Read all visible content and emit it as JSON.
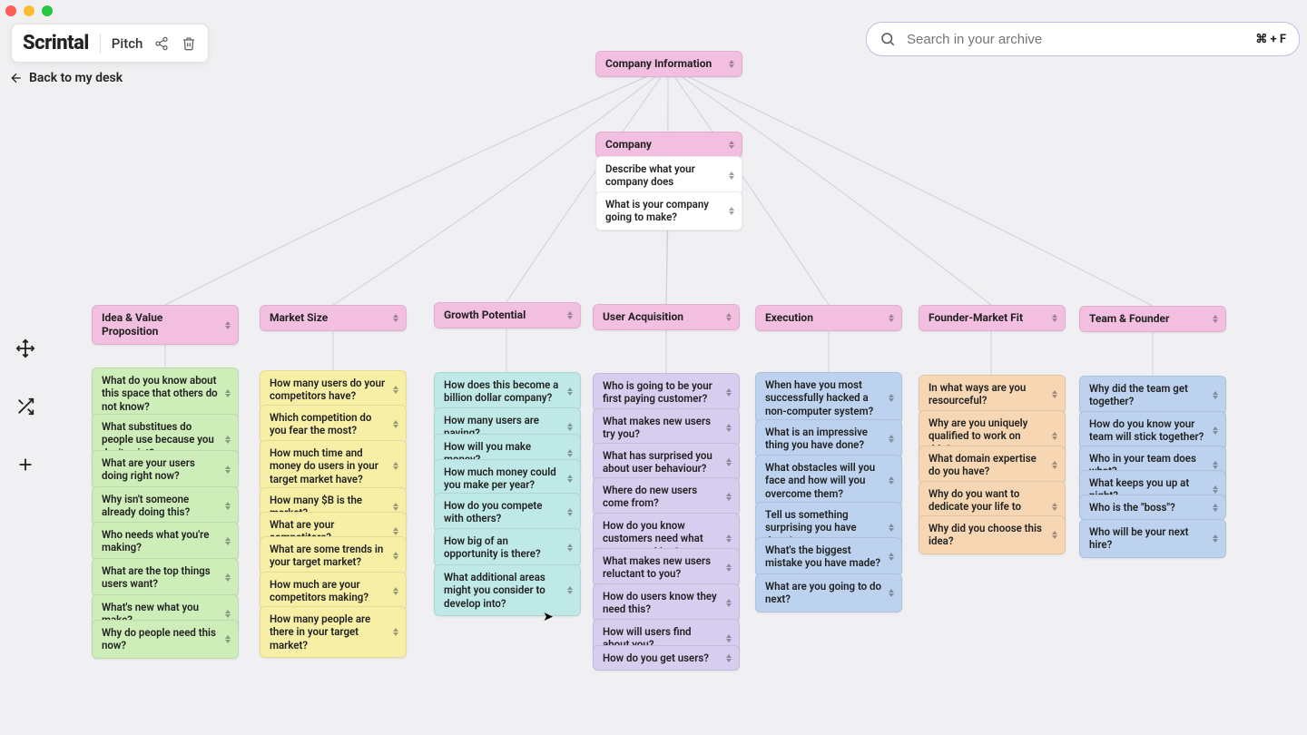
{
  "window": {
    "traffic": {
      "close": "#ff5f57",
      "min": "#febc2e",
      "max": "#28c840"
    }
  },
  "header": {
    "brand": "Scrintal",
    "doc": "Pitch",
    "back": "Back to my desk"
  },
  "search": {
    "placeholder": "Search in your archive",
    "shortcut": "⌘ + F"
  },
  "root": {
    "label": "Company Information"
  },
  "company": {
    "header": "Company",
    "q1": "Describe what your company does",
    "q2": "What is your company going to make?"
  },
  "cols": {
    "idea": {
      "title": "Idea & Value Proposition",
      "items": [
        "What do you know about this space that others do not know?",
        "What substitues do people use because you don't exist?",
        "What are your users doing right now?",
        "Why isn't someone already doing this?",
        "Who needs what you're making?",
        "What are the top things users want?",
        "What's new what you make?",
        "Why do people need this now?"
      ]
    },
    "market": {
      "title": "Market Size",
      "items": [
        "How many users do your competitors have?",
        "Which competition do you fear the most?",
        "How much time and money do users in your target market have?",
        "How many $B is the market?",
        "What are your competitors?",
        "What are some trends in your target market?",
        "How much are your competitors making?",
        "How many people are there in your target market?"
      ]
    },
    "growth": {
      "title": "Growth Potential",
      "items": [
        "How does this become a billion dollar company?",
        "How many users are paying?",
        "How will you make money?",
        "How much money could you make per year?",
        "How do you compete with others?",
        "How big of an opportunity is there?",
        "What additional areas might you consider to develop into?"
      ]
    },
    "user": {
      "title": "User Acquisition",
      "items": [
        "Who is going to be your first paying customer?",
        "What makes new users try you?",
        "What has surprised you about user behaviour?",
        "Where do new users come from?",
        "How do you know customers need what you are making?",
        "What makes new users reluctant to you?",
        "How do users know they need this?",
        "How will users find about you?",
        "How do you get users?"
      ]
    },
    "exec": {
      "title": "Execution",
      "items": [
        "When have you most successfully hacked a non-computer system?",
        "What is an impressive thing you have done?",
        "What obstacles will you face and how will you overcome them?",
        "Tell us something surprising you have done?",
        "What's the biggest mistake you have made?",
        "What are you going to do next?"
      ]
    },
    "fm": {
      "title": "Founder-Market Fit",
      "items": [
        "In what ways are you resourceful?",
        "Why are you uniquely qualified to work on this?",
        "What domain expertise do you have?",
        "Why do you want to dedicate your life to working on this?",
        "Why did you choose this idea?"
      ]
    },
    "team": {
      "title": "Team & Founder",
      "items": [
        "Why did the team get together?",
        "How do you know your team will stick together?",
        "Who in your team does what?",
        "What keeps you up at night?",
        "Who is the \"boss\"?",
        "Who will be your next hire?"
      ]
    }
  }
}
